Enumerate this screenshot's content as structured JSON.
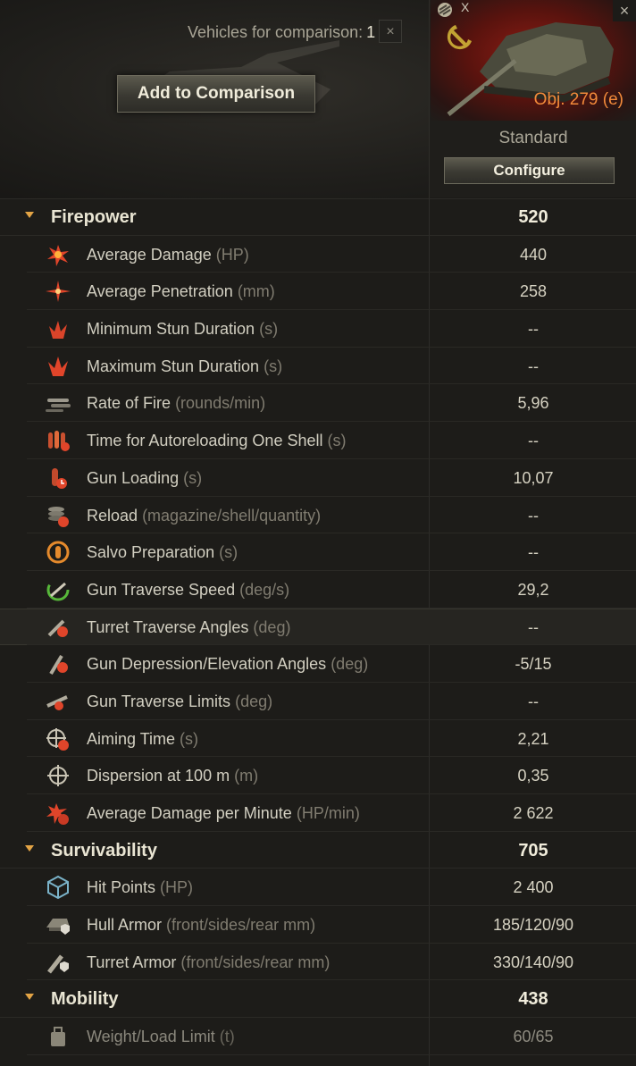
{
  "header": {
    "compare_label": "Vehicles for comparison:",
    "compare_count": "1",
    "compare_close": "×",
    "add_button": "Add to Comparison"
  },
  "vehicle": {
    "name": "Obj. 279 (e)",
    "equipment_badge": "X",
    "close": "×",
    "configuration": "Standard",
    "configure_button": "Configure"
  },
  "sections": [
    {
      "title": "Firepower",
      "value": "520",
      "rows": [
        {
          "label": "Average Damage",
          "unit": "(HP)",
          "value": "440",
          "icon": "damage-icon"
        },
        {
          "label": "Average Penetration",
          "unit": "(mm)",
          "value": "258",
          "icon": "penetration-icon"
        },
        {
          "label": "Minimum Stun Duration",
          "unit": "(s)",
          "value": "--",
          "icon": "stun-min-icon"
        },
        {
          "label": "Maximum Stun Duration",
          "unit": "(s)",
          "value": "--",
          "icon": "stun-max-icon"
        },
        {
          "label": "Rate of Fire",
          "unit": "(rounds/min)",
          "value": "5,96",
          "icon": "rate-of-fire-icon"
        },
        {
          "label": "Time for Autoreloading One Shell",
          "unit": "(s)",
          "value": "--",
          "icon": "autoreload-icon"
        },
        {
          "label": "Gun Loading",
          "unit": "(s)",
          "value": "10,07",
          "icon": "gun-loading-icon"
        },
        {
          "label": "Reload",
          "unit": "(magazine/shell/quantity)",
          "value": "--",
          "icon": "magazine-reload-icon"
        },
        {
          "label": "Salvo Preparation",
          "unit": "(s)",
          "value": "--",
          "icon": "salvo-icon"
        },
        {
          "label": "Gun Traverse Speed",
          "unit": "(deg/s)",
          "value": "29,2",
          "icon": "gun-traverse-speed-icon"
        },
        {
          "label": "Turret Traverse Angles",
          "unit": "(deg)",
          "value": "--",
          "icon": "turret-traverse-icon"
        },
        {
          "label": "Gun Depression/Elevation Angles",
          "unit": "(deg)",
          "value": "-5/15",
          "icon": "gun-elevation-icon"
        },
        {
          "label": "Gun Traverse Limits",
          "unit": "(deg)",
          "value": "--",
          "icon": "gun-traverse-limits-icon"
        },
        {
          "label": "Aiming Time",
          "unit": "(s)",
          "value": "2,21",
          "icon": "aiming-time-icon"
        },
        {
          "label": "Dispersion at 100 m",
          "unit": "(m)",
          "value": "0,35",
          "icon": "dispersion-icon"
        },
        {
          "label": "Average Damage per Minute",
          "unit": "(HP/min)",
          "value": "2 622",
          "icon": "dpm-icon"
        }
      ]
    },
    {
      "title": "Survivability",
      "value": "705",
      "rows": [
        {
          "label": "Hit Points",
          "unit": "(HP)",
          "value": "2 400",
          "icon": "hit-points-icon"
        },
        {
          "label": "Hull Armor",
          "unit": "(front/sides/rear mm)",
          "value": "185/120/90",
          "icon": "hull-armor-icon"
        },
        {
          "label": "Turret Armor",
          "unit": "(front/sides/rear mm)",
          "value": "330/140/90",
          "icon": "turret-armor-icon"
        }
      ]
    },
    {
      "title": "Mobility",
      "value": "438",
      "rows": [
        {
          "label": "Weight/Load Limit",
          "unit": "(t)",
          "value": "60/65",
          "icon": "weight-icon"
        }
      ]
    }
  ],
  "colors": {
    "accent_orange": "#e3a445",
    "vehicle_name": "#f28a3a",
    "icon_red": "#e0452a"
  }
}
